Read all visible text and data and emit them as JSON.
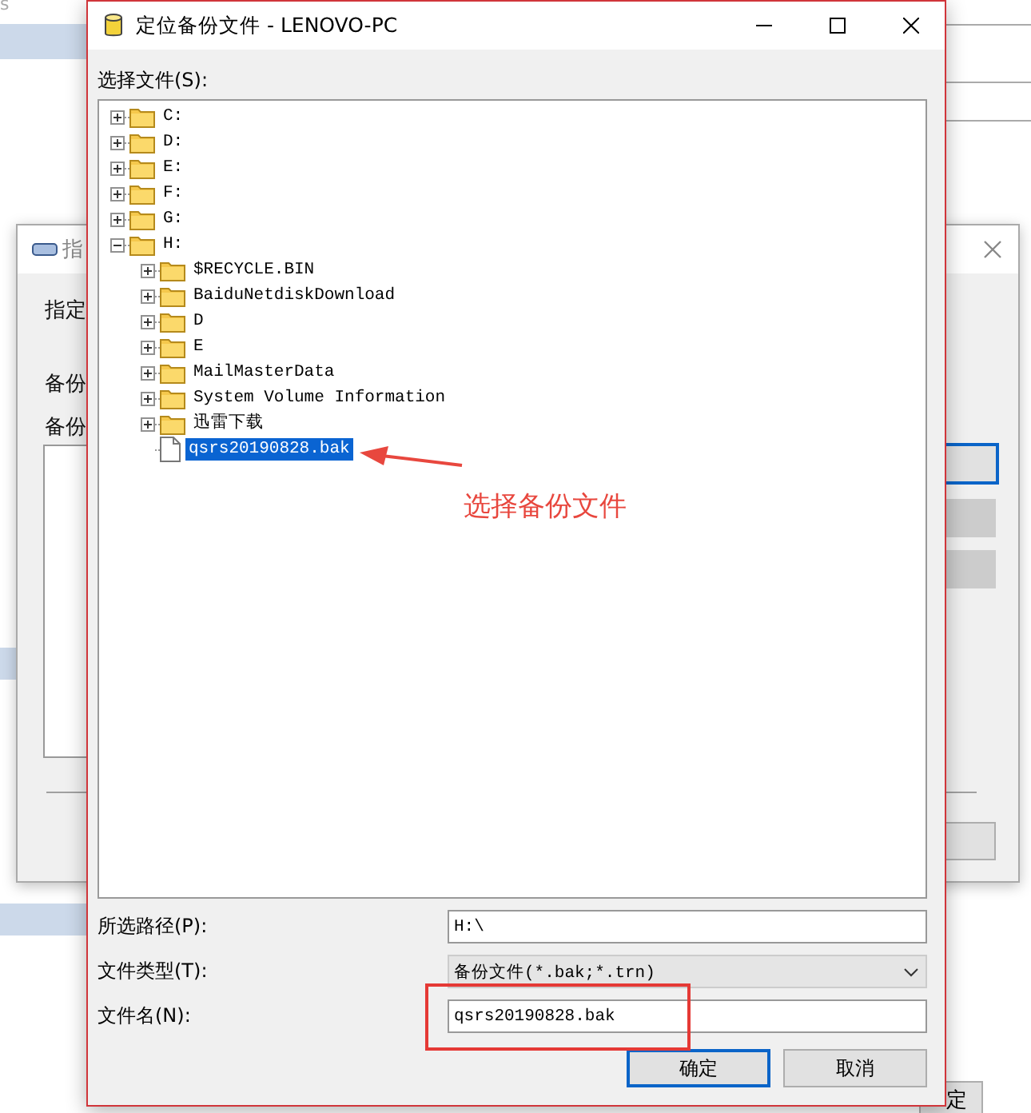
{
  "background_text": "s",
  "background_window": {
    "title": "指",
    "texts": [
      "指定",
      "备份",
      "备份"
    ],
    "buttons": [
      {
        "default": true
      },
      {
        "default": false
      },
      {
        "default": false
      },
      {
        "default": false
      }
    ]
  },
  "background_button": "定",
  "dialog": {
    "title": "定位备份文件 - LENOVO-PC",
    "tree_label": "选择文件(S):",
    "tree": [
      {
        "label": "C:",
        "kind": "folder",
        "expanded": false,
        "selected": false
      },
      {
        "label": "D:",
        "kind": "folder",
        "expanded": false,
        "selected": false
      },
      {
        "label": "E:",
        "kind": "folder",
        "expanded": false,
        "selected": false
      },
      {
        "label": "F:",
        "kind": "folder",
        "expanded": false,
        "selected": false
      },
      {
        "label": "G:",
        "kind": "folder",
        "expanded": false,
        "selected": false
      },
      {
        "label": "H:",
        "kind": "folder",
        "expanded": true,
        "selected": false,
        "children": [
          {
            "label": "$RECYCLE.BIN",
            "kind": "folder",
            "expanded": false,
            "selected": false
          },
          {
            "label": "BaiduNetdiskDownload",
            "kind": "folder",
            "expanded": false,
            "selected": false
          },
          {
            "label": "D",
            "kind": "folder",
            "expanded": false,
            "selected": false
          },
          {
            "label": "E",
            "kind": "folder",
            "expanded": false,
            "selected": false
          },
          {
            "label": "MailMasterData",
            "kind": "folder",
            "expanded": false,
            "selected": false
          },
          {
            "label": "System Volume Information",
            "kind": "folder",
            "expanded": false,
            "selected": false
          },
          {
            "label": "迅雷下载",
            "kind": "folder",
            "expanded": false,
            "selected": false
          },
          {
            "label": "qsrs20190828.bak",
            "kind": "file",
            "selected": true
          }
        ]
      }
    ],
    "path_label": "所选路径(P):",
    "path_value": "H:\\",
    "type_label": "文件类型(T):",
    "type_value": "备份文件(*.bak;*.trn)",
    "name_label": "文件名(N):",
    "name_value": "qsrs20190828.bak",
    "buttons": [
      {
        "label": "确定",
        "default": true
      },
      {
        "label": "取消",
        "default": false
      }
    ]
  },
  "annotation": {
    "text": "选择备份文件"
  }
}
